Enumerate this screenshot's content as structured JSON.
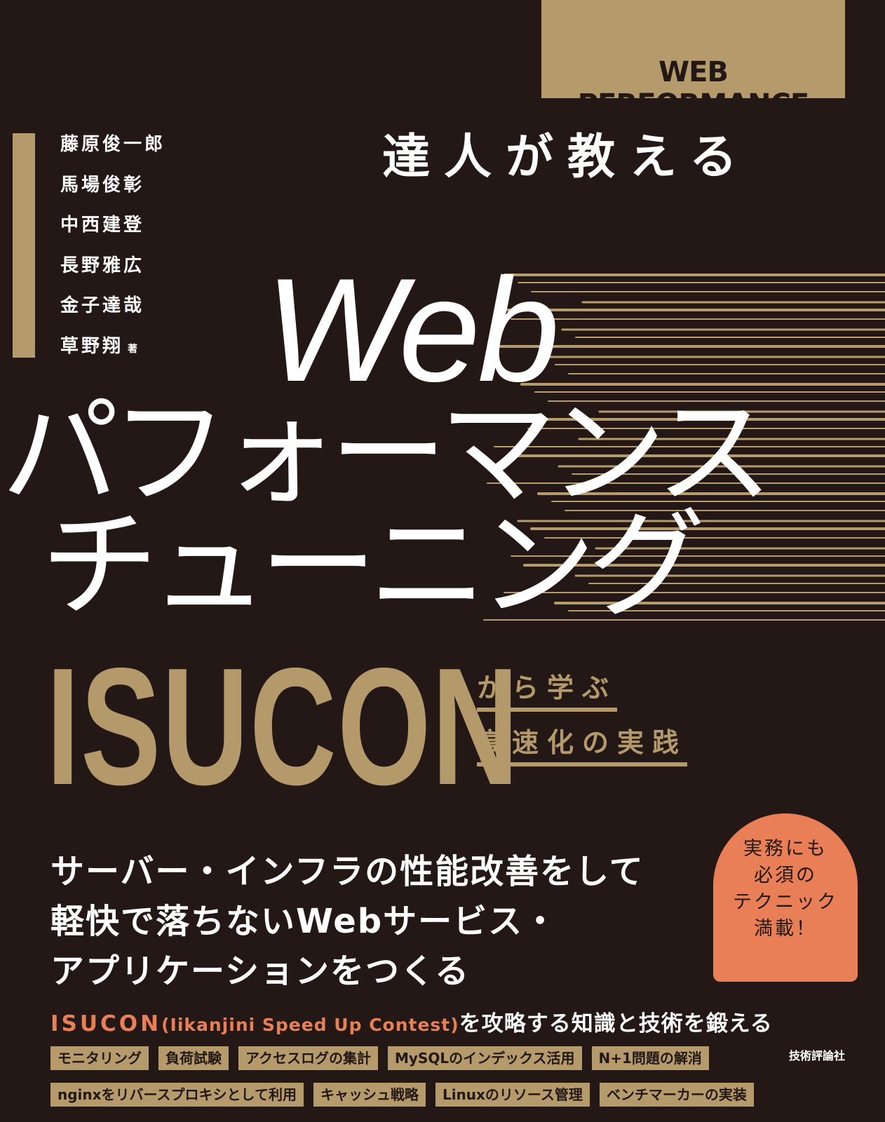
{
  "cover": {
    "series_label": "WEB PERFORMANCE TUNING",
    "authors": [
      "藤原俊一郎",
      "馬場俊彰",
      "中西建登",
      "長野雅広",
      "金子達哉",
      "草野翔"
    ],
    "authors_suffix": "著",
    "subtitle_top": "達人が教える",
    "title_web": "Web",
    "title_line2": "パフォーマンス",
    "title_line3": "チューニング",
    "isucon": "ISUCON",
    "from_learn": "から学ぶ",
    "practice": "高速化の実践",
    "badge": [
      "実務にも",
      "必須の",
      "テクニック",
      "満載！"
    ],
    "lead": [
      "サーバー・インフラの性能改善をして",
      "軽快で落ちないWebサービス・",
      "アプリケーションをつくる"
    ],
    "tagline": {
      "isucon": "ISUCON",
      "paren": "(Iikanjini Speed Up Contest)",
      "rest": "を攻略する知識と技術を鍛える"
    },
    "tags_row1": [
      "モニタリング",
      "負荷試験",
      "アクセスログの集計",
      "MySQLのインデックス活用",
      "N+1問題の解消"
    ],
    "tags_row2": [
      "nginxをリバースプロキシとして利用",
      "キャッシュ戦略",
      "Linuxのリソース管理",
      "ベンチマーカーの実装"
    ],
    "publisher": "技術評論社"
  },
  "colors": {
    "background": "#231815",
    "gold": "#b59a6c",
    "accent_orange": "#e87f56",
    "text": "#ffffff"
  }
}
